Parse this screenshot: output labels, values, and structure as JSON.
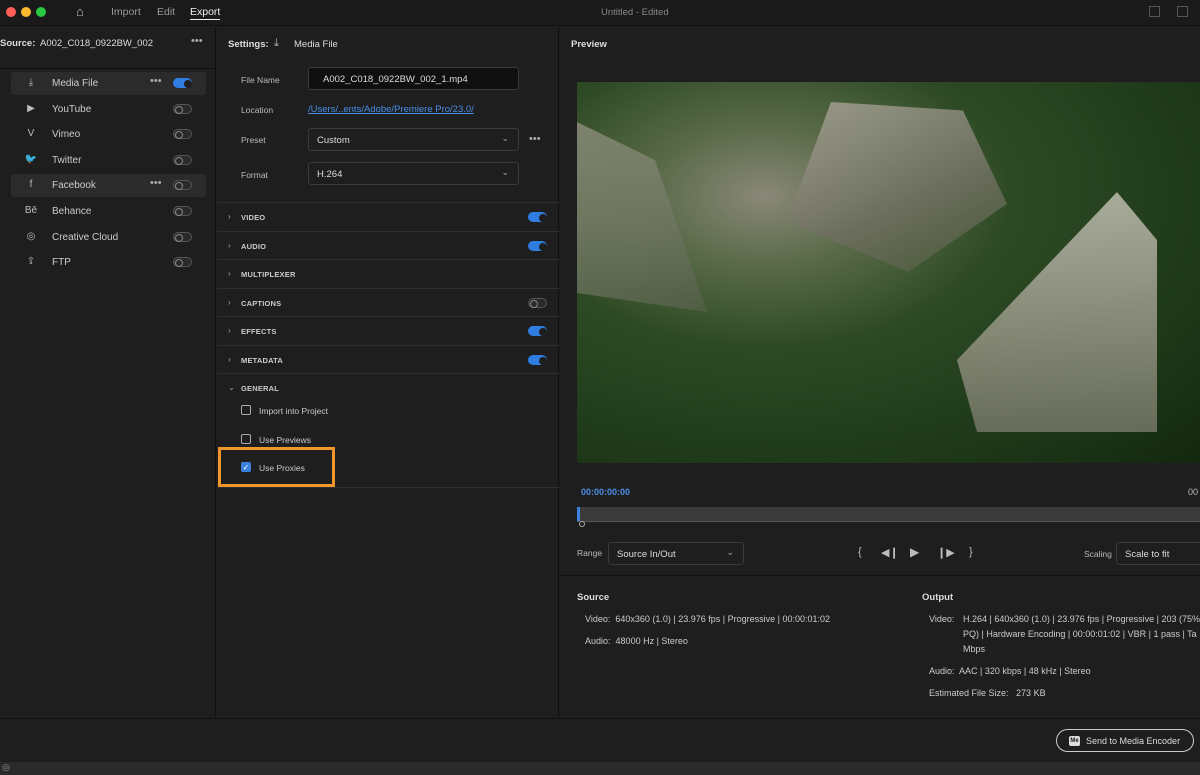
{
  "titlebar": {
    "nav": [
      "Import",
      "Edit",
      "Export"
    ],
    "active": "Export",
    "title": "Untitled",
    "status": "- Edited"
  },
  "source": {
    "label": "Source:",
    "name": "A002_C018_0922BW_002"
  },
  "destinations": [
    {
      "label": "Media File",
      "icon": "download-icon",
      "on": true,
      "selected": true
    },
    {
      "label": "YouTube",
      "icon": "youtube-icon",
      "on": false
    },
    {
      "label": "Vimeo",
      "icon": "vimeo-icon",
      "on": false
    },
    {
      "label": "Twitter",
      "icon": "twitter-icon",
      "on": false
    },
    {
      "label": "Facebook",
      "icon": "facebook-icon",
      "on": false,
      "selected": true
    },
    {
      "label": "Behance",
      "icon": "behance-icon",
      "on": false
    },
    {
      "label": "Creative Cloud",
      "icon": "creative-cloud-icon",
      "on": false
    },
    {
      "label": "FTP",
      "icon": "ftp-icon",
      "on": false
    }
  ],
  "settings": {
    "label": "Settings:",
    "dest": "Media File",
    "file_name_label": "File Name",
    "file_name": "A002_C018_0922BW_002_1.mp4",
    "location_label": "Location",
    "location": "/Users/..ents/Adobe/Premiere Pro/23.0/",
    "preset_label": "Preset",
    "preset": "Custom",
    "format_label": "Format",
    "format": "H.264"
  },
  "sections": [
    {
      "title": "VIDEO",
      "on": true
    },
    {
      "title": "AUDIO",
      "on": true
    },
    {
      "title": "MULTIPLEXER"
    },
    {
      "title": "CAPTIONS",
      "on": false
    },
    {
      "title": "EFFECTS",
      "on": true
    },
    {
      "title": "METADATA",
      "on": true
    },
    {
      "title": "GENERAL",
      "expanded": true
    }
  ],
  "general": [
    {
      "label": "Import into Project",
      "checked": false
    },
    {
      "label": "Use Previews",
      "checked": false
    },
    {
      "label": "Use Proxies",
      "checked": true
    }
  ],
  "preview": {
    "title": "Preview",
    "timecode": "00:00:00:00",
    "end_timecode": "00",
    "range_label": "Range",
    "range": "Source In/Out",
    "scaling_label": "Scaling",
    "scaling": "Scale to fit"
  },
  "source_info": {
    "title": "Source",
    "video_label": "Video:",
    "video": "640x360 (1.0)  |  23.976 fps  |  Progressive  |  00:00:01:02",
    "audio_label": "Audio:",
    "audio": "48000 Hz  |  Stereo"
  },
  "output_info": {
    "title": "Output",
    "video_label": "Video:",
    "video_1": "H.264  |  640x360 (1.0)  |  23.976 fps  |  Progressive  |  203 (75%",
    "video_2": "PQ)  |  Hardware Encoding  |  00:00:01:02   |  VBR  |  1 pass  |  Ta",
    "video_3": "Mbps",
    "audio_label": "Audio:",
    "audio": "AAC  |  320 kbps  |  48 kHz  |  Stereo",
    "size_label": "Estimated File Size:",
    "size": "273 KB"
  },
  "footer": {
    "send_button": "Send to Media Encoder",
    "me_badge": "Me"
  },
  "colors": {
    "accent": "#2f7de1",
    "highlight": "#f0962a",
    "link": "#4a8ee8"
  }
}
